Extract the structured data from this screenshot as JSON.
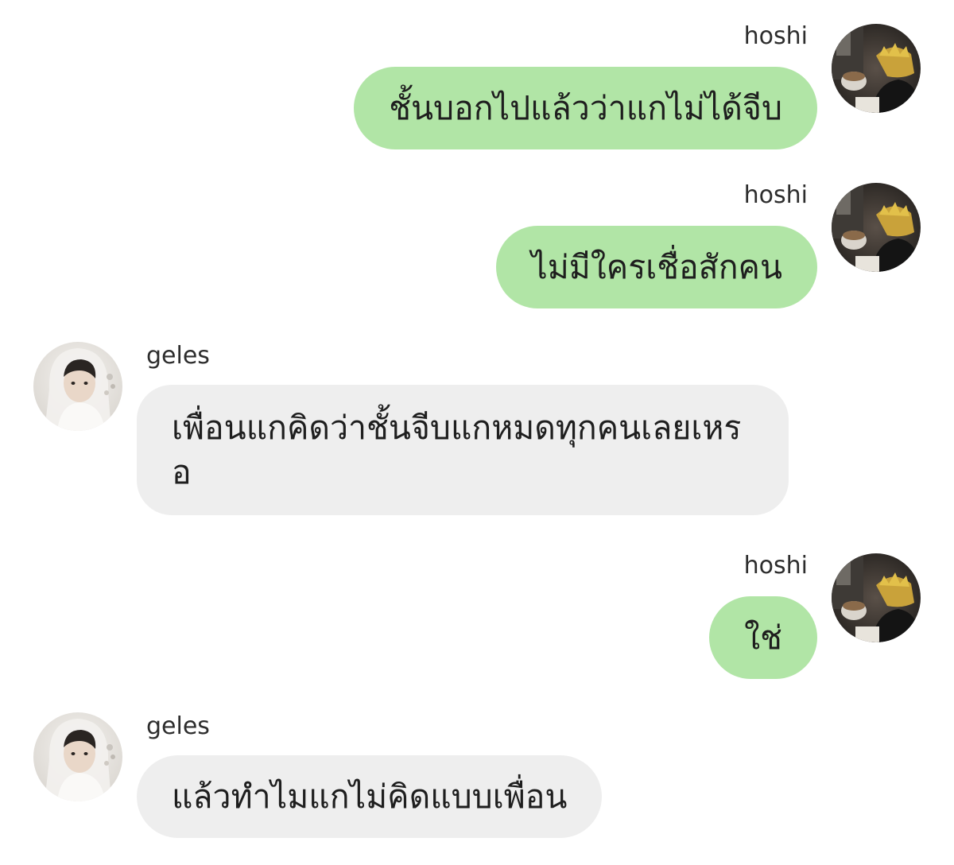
{
  "chat": {
    "messages": [
      {
        "sender": "hoshi",
        "side": "sent",
        "text": "ชั้นบอกไปแล้วว่าแกไม่ได้จีบ",
        "avatar_icon": "user-photo-icon"
      },
      {
        "sender": "hoshi",
        "side": "sent",
        "text": "ไม่มีใครเชื่อสักคน",
        "avatar_icon": "user-photo-icon"
      },
      {
        "sender": "geles",
        "side": "received",
        "text": "เพื่อนแกคิดว่าชั้นจีบแกหมดทุกคนเลยเหรอ",
        "avatar_icon": "user-photo-icon"
      },
      {
        "sender": "hoshi",
        "side": "sent",
        "text": "ใช่",
        "avatar_icon": "user-photo-icon"
      },
      {
        "sender": "geles",
        "side": "received",
        "text": "แล้วทำไมแกไม่คิดแบบเพื่อน",
        "avatar_icon": "user-photo-icon"
      }
    ]
  },
  "colors": {
    "sent_bubble": "#b1e5a6",
    "received_bubble": "#eeeeee",
    "background": "#ffffff"
  }
}
